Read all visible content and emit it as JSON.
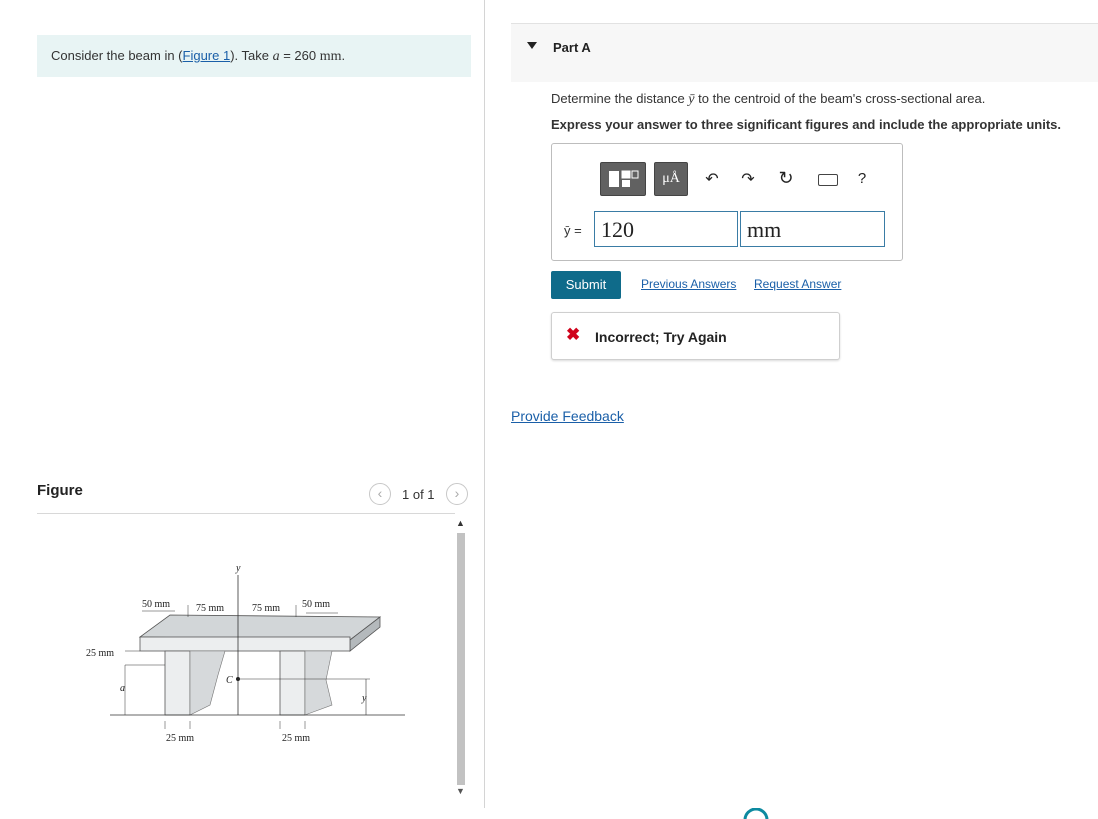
{
  "problem": {
    "prefix": "Consider the beam in (",
    "figure_link": "Figure 1",
    "middle": "). Take ",
    "var": "a",
    "equals": " = 260 ",
    "unit": "mm",
    "suffix": "."
  },
  "figure": {
    "label": "Figure",
    "page_count": "1 of 1",
    "prev_icon": "chevron-left-icon",
    "next_icon": "chevron-right-icon",
    "dims": {
      "top_left_flange": "50 mm",
      "left_75": "75 mm",
      "right_75": "75 mm",
      "top_right_flange": "50 mm",
      "flange_thickness": "25 mm",
      "a": "a",
      "c": "C",
      "y_axis": "y",
      "ybar": "y",
      "left_web": "25 mm",
      "right_web": "25 mm"
    }
  },
  "part": {
    "title": "Part A",
    "question_prefix": "Determine the distance ",
    "question_var": "ȳ",
    "question_suffix": " to the centroid of the beam's cross-sectional area.",
    "instruction": "Express your answer to three significant figures and include the appropriate units."
  },
  "toolbar": {
    "templates_icon": "templates-icon",
    "units_label": "μÅ",
    "undo_icon": "undo-icon",
    "redo_icon": "redo-icon",
    "reset_icon": "reset-icon",
    "keyboard_icon": "keyboard-icon",
    "help_label": "?"
  },
  "answer": {
    "label": "ȳ =",
    "value": "120",
    "units": "mm"
  },
  "actions": {
    "submit": "Submit",
    "previous_answers": "Previous Answers",
    "request_answer": "Request Answer"
  },
  "feedback": {
    "icon": "x-icon",
    "message": "Incorrect; Try Again",
    "provide_feedback": "Provide Feedback"
  },
  "colors": {
    "problem_bg": "#e8f4f4",
    "submit_bg": "#0f6b8a",
    "link": "#1a5fa8",
    "error": "#d0021b"
  }
}
